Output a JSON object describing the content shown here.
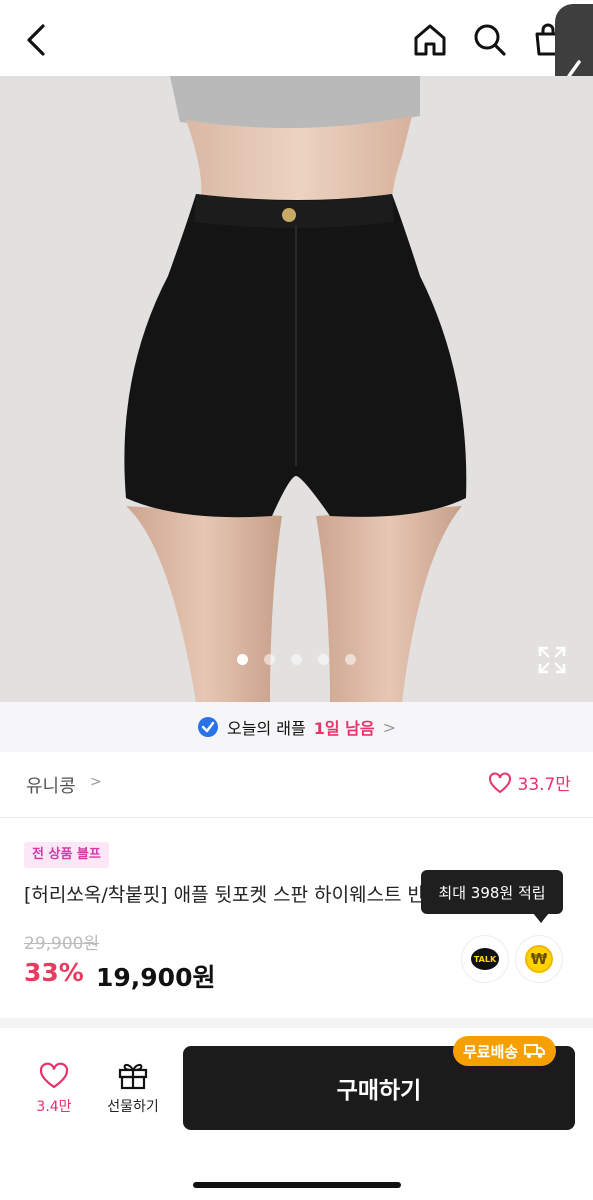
{
  "header": {
    "icons": [
      "back-chevron-icon",
      "home-icon",
      "search-icon",
      "cart-icon",
      "side-panel-chevron-icon"
    ]
  },
  "gallery": {
    "image_count": 5,
    "active_index": 0
  },
  "raffle": {
    "label": "오늘의 래플",
    "remaining": "1일 남음",
    "chevron": ">"
  },
  "brand": {
    "name": "유니콩",
    "chevron": ">",
    "likes": "33.7만"
  },
  "product": {
    "tag": "전 상품 블프",
    "title": "[허리쏘옥/착붙핏] 애플 뒷포켓 스판 하이웨스트 반바지",
    "original_price": "29,900원",
    "discount": "33%",
    "price": "19,900원",
    "points_tooltip": "최대 398원 적립",
    "talk_label": "TALK",
    "won_symbol": "₩"
  },
  "bottom_bar": {
    "wish_count": "3.4만",
    "gift_label": "선물하기",
    "buy_label": "구매하기",
    "shipping_badge": "무료배송"
  },
  "colors": {
    "accent_pink": "#e8336a",
    "discount_red": "#ea3b5f",
    "tag_bg": "#fbe7f6",
    "shipping_orange": "#f5a000",
    "buy_button": "#1b1b1b"
  }
}
